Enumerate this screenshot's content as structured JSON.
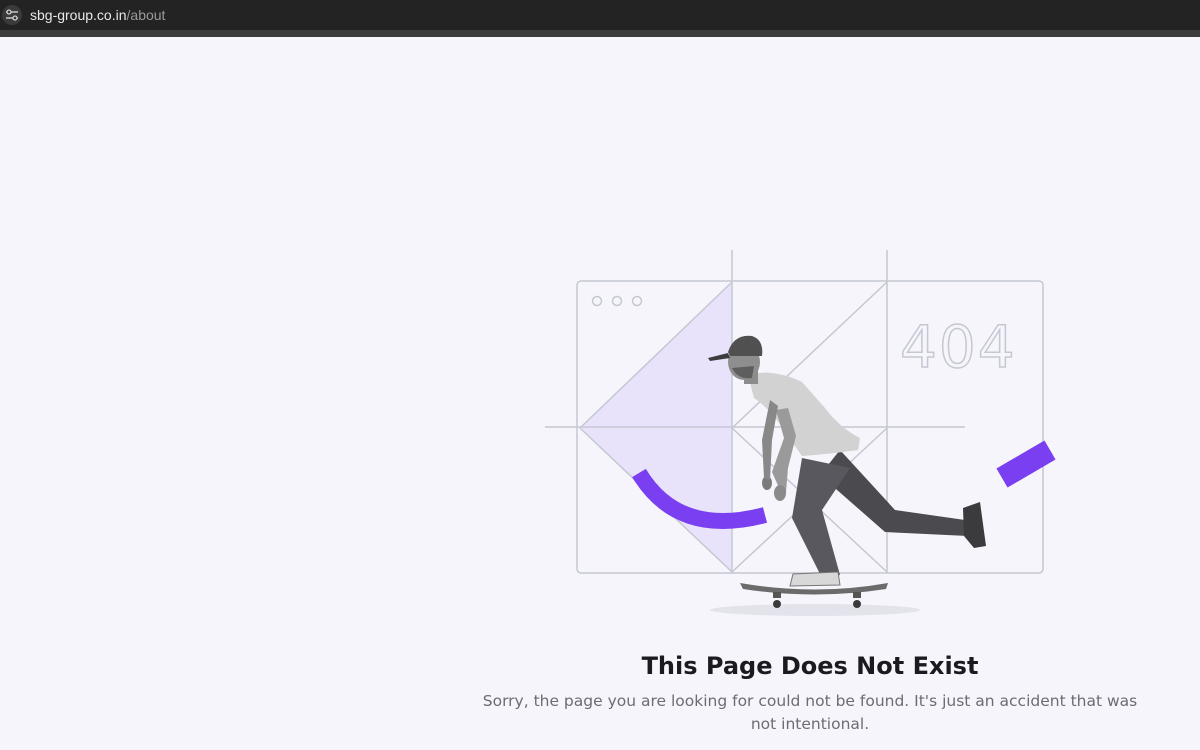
{
  "browser": {
    "url_host": "sbg-group.co.in",
    "url_path": "/about",
    "site_info_icon": "tune-icon"
  },
  "illustration": {
    "code_text": "404",
    "accent_color": "#7a3ff0",
    "panel_color": "#e9e2fb",
    "line_color": "#c5c8d2"
  },
  "error": {
    "title": "This Page Does Not Exist",
    "message": "Sorry, the page you are looking for could not be found. It's just an accident that was not intentional."
  }
}
